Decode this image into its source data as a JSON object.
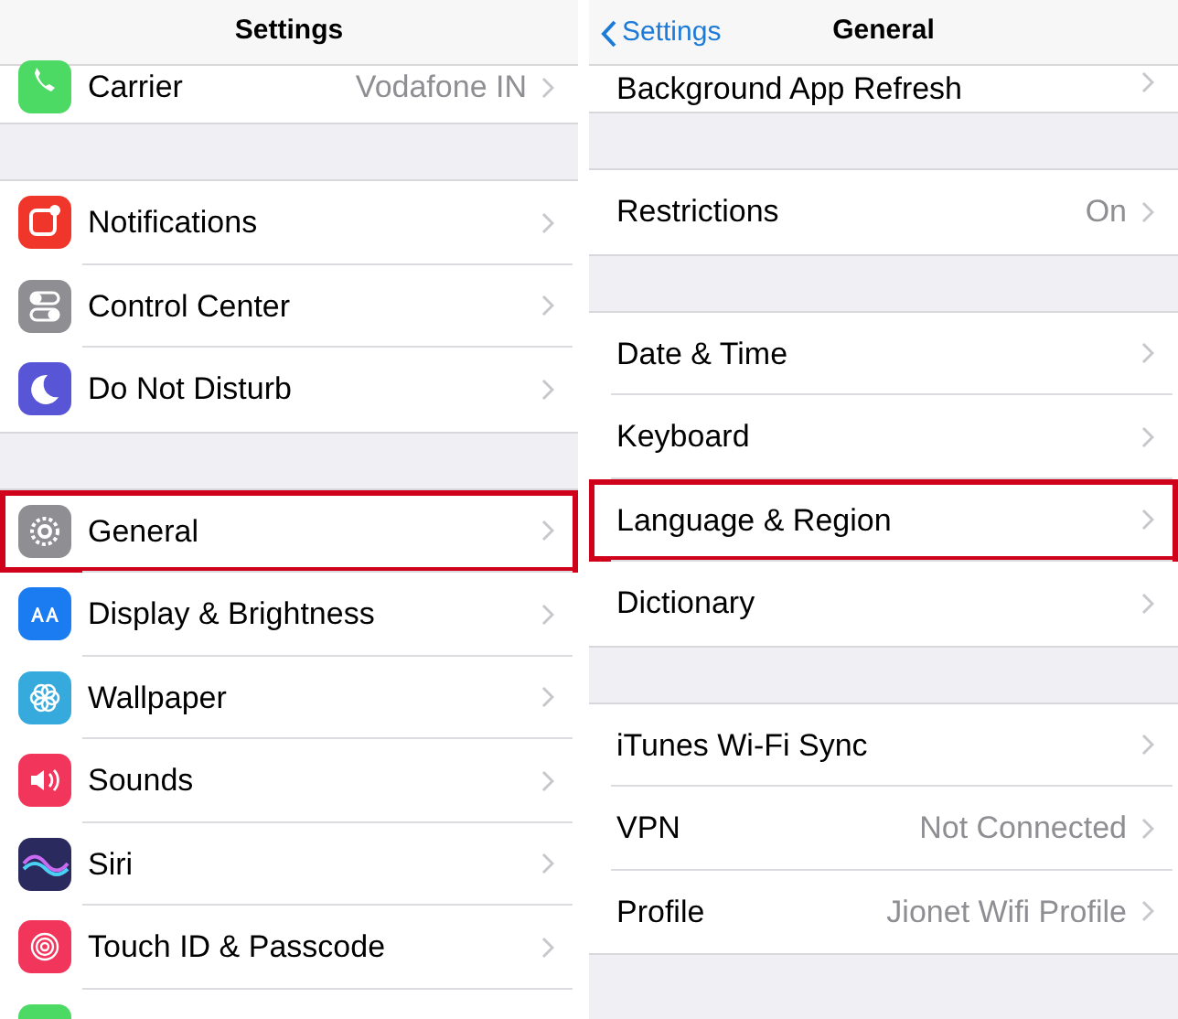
{
  "panels": [
    {
      "title": "Settings",
      "sections": [
        [
          {
            "label": "Carrier",
            "value": "Vodafone IN",
            "color": "#4cd964",
            "highlighted": false
          }
        ],
        [
          {
            "label": "Notifications",
            "color": "#f0362b",
            "highlighted": false
          },
          {
            "label": "Control Center",
            "color": "#8e8e93",
            "highlighted": false
          },
          {
            "label": "Do Not Disturb",
            "color": "#5856d6",
            "highlighted": false
          }
        ],
        [
          {
            "label": "General",
            "color": "#8e8e93",
            "highlighted": true
          },
          {
            "label": "Display & Brightness",
            "color": "#1a7cf0",
            "highlighted": false
          },
          {
            "label": "Wallpaper",
            "color": "#36aadc",
            "highlighted": false
          },
          {
            "label": "Sounds",
            "color": "#f2355b",
            "highlighted": false
          },
          {
            "label": "Siri",
            "color": "#2a2a5e",
            "highlighted": false
          },
          {
            "label": "Touch ID & Passcode",
            "color": "#f2355b",
            "highlighted": false
          },
          {
            "color": "#4cd964",
            "highlighted": false
          }
        ]
      ]
    },
    {
      "title": "General",
      "back": "Settings",
      "sections": [
        [
          {
            "label": "Background App Refresh",
            "highlighted": false
          }
        ],
        [
          {
            "label": "Restrictions",
            "value": "On",
            "highlighted": false
          }
        ],
        [
          {
            "label": "Date & Time",
            "highlighted": false
          },
          {
            "label": "Keyboard",
            "highlighted": false
          },
          {
            "label": "Language & Region",
            "highlighted": true
          },
          {
            "label": "Dictionary",
            "highlighted": false
          }
        ],
        [
          {
            "label": "iTunes Wi-Fi Sync",
            "highlighted": false
          },
          {
            "label": "VPN",
            "value": "Not Connected",
            "highlighted": false
          },
          {
            "label": "Profile",
            "value": "Jionet Wifi Profile",
            "highlighted": false
          }
        ]
      ]
    }
  ]
}
